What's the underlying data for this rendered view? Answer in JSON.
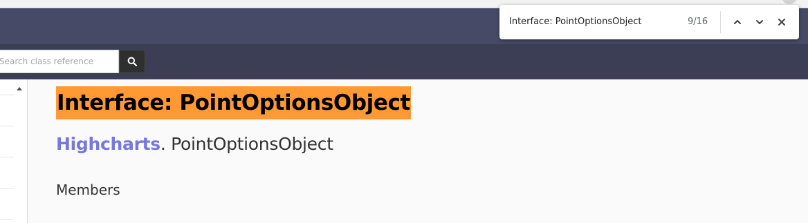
{
  "search": {
    "placeholder": "Search class reference",
    "button_icon": "search-icon"
  },
  "page": {
    "title": "Interface: PointOptionsObject",
    "breadcrumb_namespace": "Highcharts",
    "breadcrumb_separator": ". ",
    "breadcrumb_name": "PointOptionsObject",
    "members_heading": "Members"
  },
  "find_bar": {
    "query": "Interface: PointOptionsObject",
    "count": "9/16",
    "prev_icon": "chevron-up-icon",
    "next_icon": "chevron-down-icon",
    "close_icon": "close-icon"
  },
  "colors": {
    "header_top": "#474a66",
    "header_bottom": "#3b3e54",
    "find_highlight": "#ff9933",
    "link": "#7777dd"
  }
}
